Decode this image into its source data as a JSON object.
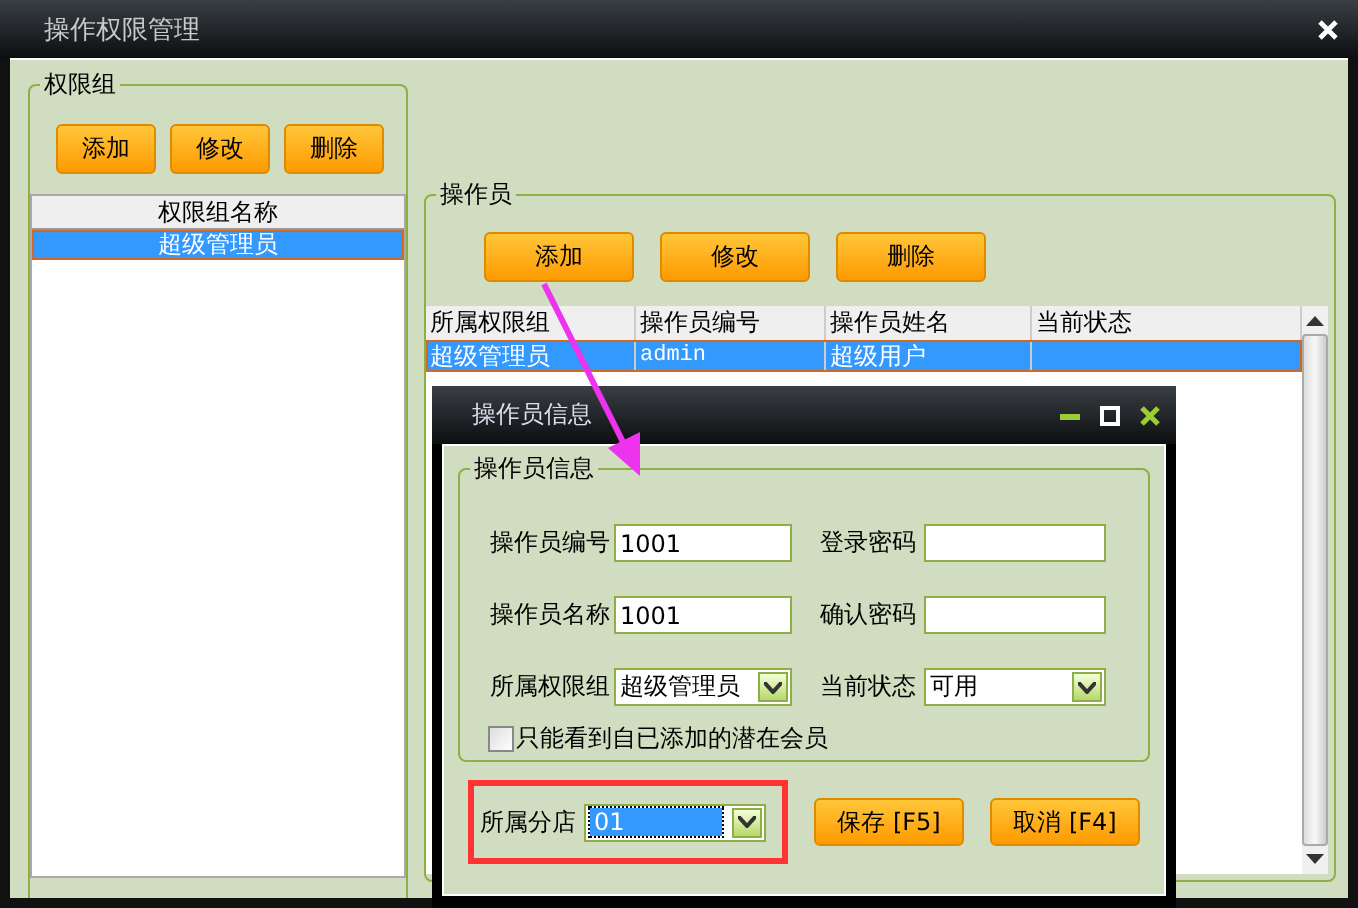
{
  "window": {
    "title": "操作权限管理"
  },
  "permission_groups": {
    "legend": "权限组",
    "buttons": [
      "添加",
      "修改",
      "删除"
    ],
    "column": "权限组名称",
    "rows": [
      {
        "name": "超级管理员",
        "selected": true
      }
    ]
  },
  "operators": {
    "legend": "操作员",
    "buttons": [
      "添加",
      "修改",
      "删除"
    ],
    "columns": [
      "所属权限组",
      "操作员编号",
      "操作员姓名",
      "当前状态"
    ],
    "rows": [
      {
        "cells": [
          "超级管理员",
          "admin",
          "超级用户",
          ""
        ],
        "selected": true
      }
    ]
  },
  "dialog": {
    "title": "操作员信息",
    "legend": "操作员信息",
    "fields": [
      {
        "label": "操作员编号",
        "value": "1001",
        "kind": "text"
      },
      {
        "label": "登录密码",
        "kind": "text"
      },
      {
        "label": "操作员名称",
        "value": "1001",
        "kind": "text"
      },
      {
        "label": "确认密码",
        "kind": "text"
      },
      {
        "label": "所属权限组",
        "value": "超级管理员",
        "kind": "select"
      },
      {
        "label": "当前状态",
        "value": "可用",
        "kind": "select"
      }
    ],
    "checkbox": {
      "label": "只能看到自已添加的潜在会员",
      "checked": false
    },
    "branch": {
      "label": "所属分店",
      "value": "01",
      "highlighted": true
    },
    "buttons": [
      "保存 [F5]",
      "取消 [F4]"
    ]
  }
}
